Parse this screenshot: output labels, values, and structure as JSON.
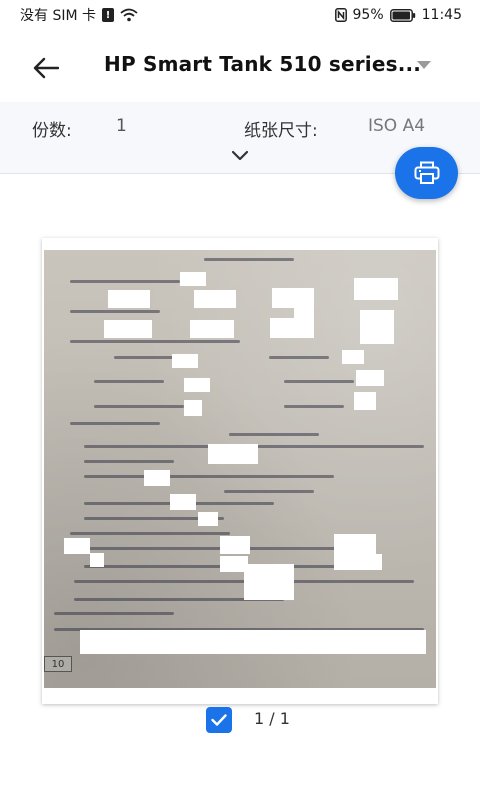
{
  "status_bar": {
    "carrier": "没有 SIM 卡",
    "sim_alert_glyph": "!",
    "battery_percent": "95%",
    "time": "11:45",
    "icons": [
      "sim-alert-icon",
      "wifi-icon",
      "nfc-icon",
      "battery-icon"
    ]
  },
  "app_bar": {
    "back_icon": "arrow-back-icon",
    "printer_name": "HP Smart Tank 510 series...",
    "dropdown_icon": "dropdown-triangle-icon"
  },
  "settings": {
    "copies_label": "份数:",
    "copies_value": "1",
    "paper_size_label": "纸张尺寸:",
    "paper_size_value": "ISO A4",
    "expand_icon": "chevron-down-icon"
  },
  "print_fab": {
    "icon": "printer-icon",
    "color": "#1a73e8"
  },
  "preview": {
    "page_number": "10"
  },
  "pager": {
    "selected": true,
    "counter": "1 / 1"
  },
  "colors": {
    "accent": "#1a73e8",
    "panel_bg": "#f6f8fc"
  }
}
